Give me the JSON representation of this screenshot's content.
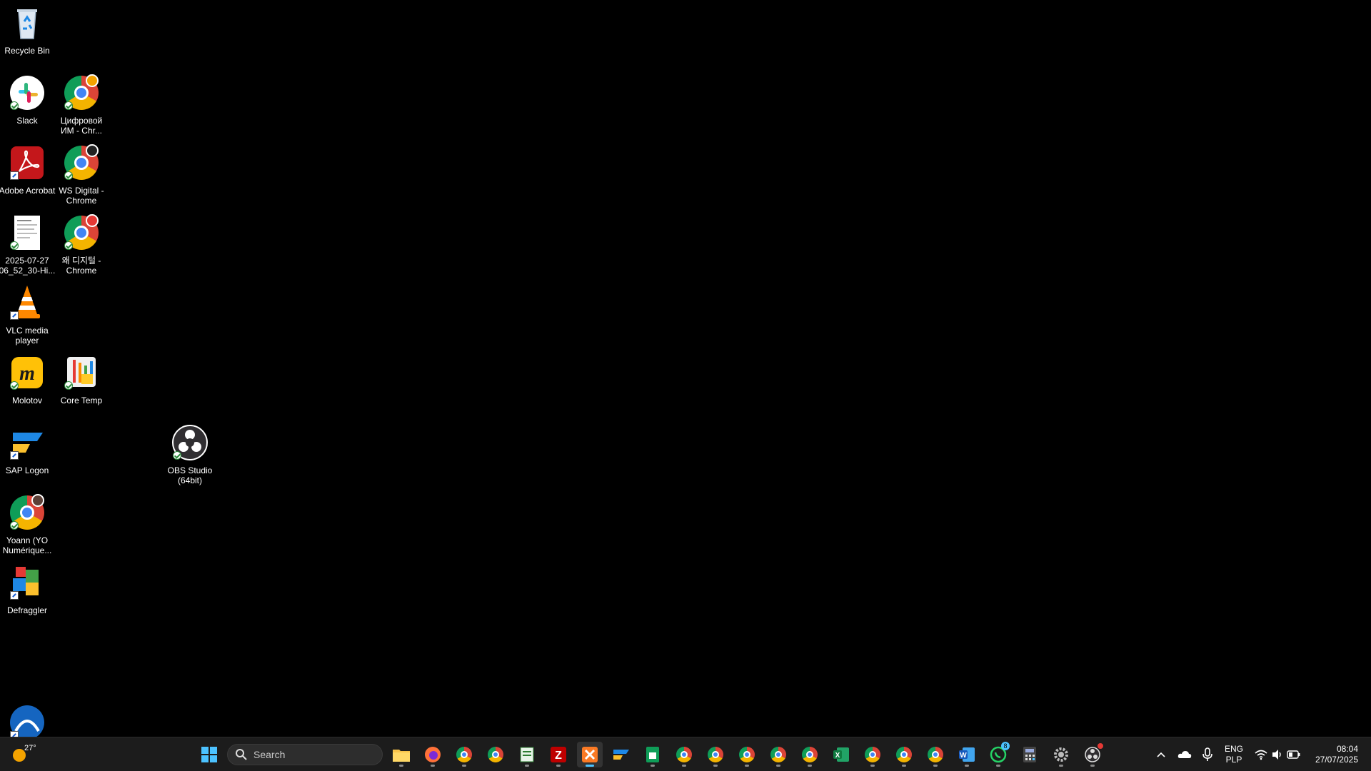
{
  "desktop": {
    "icons": [
      {
        "id": "recycle-bin",
        "label": "Recycle Bin"
      },
      {
        "id": "slack",
        "label": "Slack"
      },
      {
        "id": "chrome-cifrovoy",
        "label": "Цифровой ИМ - Chr..."
      },
      {
        "id": "adobe-acrobat",
        "label": "Adobe Acrobat"
      },
      {
        "id": "chrome-ws-digital",
        "label": "WS Digital - Chrome"
      },
      {
        "id": "document-file",
        "label": "2025-07-27 06_52_30-Hi..."
      },
      {
        "id": "chrome-korean",
        "label": "왜 디지털 - Chrome"
      },
      {
        "id": "vlc",
        "label": "VLC media player"
      },
      {
        "id": "molotov",
        "label": "Molotov"
      },
      {
        "id": "core-temp",
        "label": "Core Temp"
      },
      {
        "id": "sap-logon",
        "label": "SAP Logon"
      },
      {
        "id": "obs",
        "label": "OBS Studio (64bit)"
      },
      {
        "id": "chrome-yoann",
        "label": "Yoann (YO Numérique..."
      },
      {
        "id": "defraggler",
        "label": "Defraggler"
      }
    ]
  },
  "taskbar": {
    "weather_temp": "27°",
    "search_placeholder": "Search",
    "tray": {
      "language": "ENG",
      "layout": "PLP",
      "time": "08:04",
      "date": "27/07/2025"
    },
    "whatsapp_badge": "8"
  }
}
